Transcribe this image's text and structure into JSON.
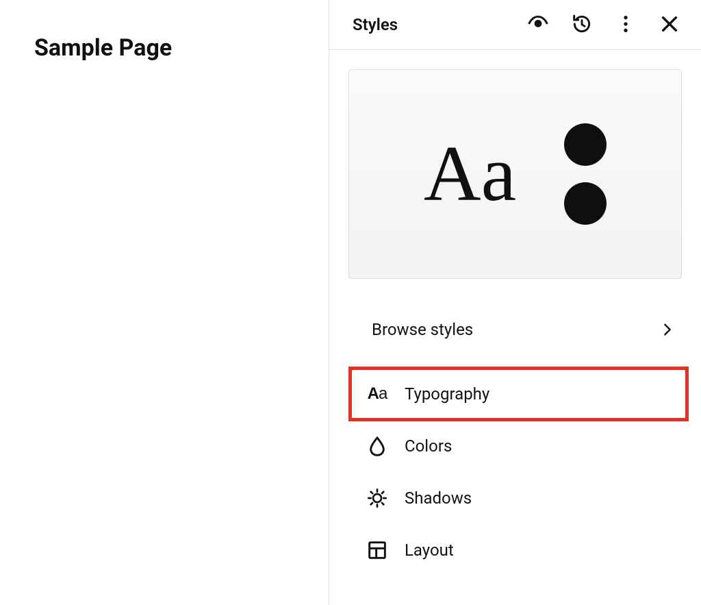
{
  "main": {
    "page_title": "Sample Page"
  },
  "sidebar": {
    "title": "Styles",
    "preview_text": "Aa",
    "browse_label": "Browse styles",
    "items": [
      {
        "label": "Typography",
        "icon": "typography-icon",
        "highlighted": true
      },
      {
        "label": "Colors",
        "icon": "color-drop-icon",
        "highlighted": false
      },
      {
        "label": "Shadows",
        "icon": "shadows-icon",
        "highlighted": false
      },
      {
        "label": "Layout",
        "icon": "layout-icon",
        "highlighted": false
      }
    ]
  }
}
